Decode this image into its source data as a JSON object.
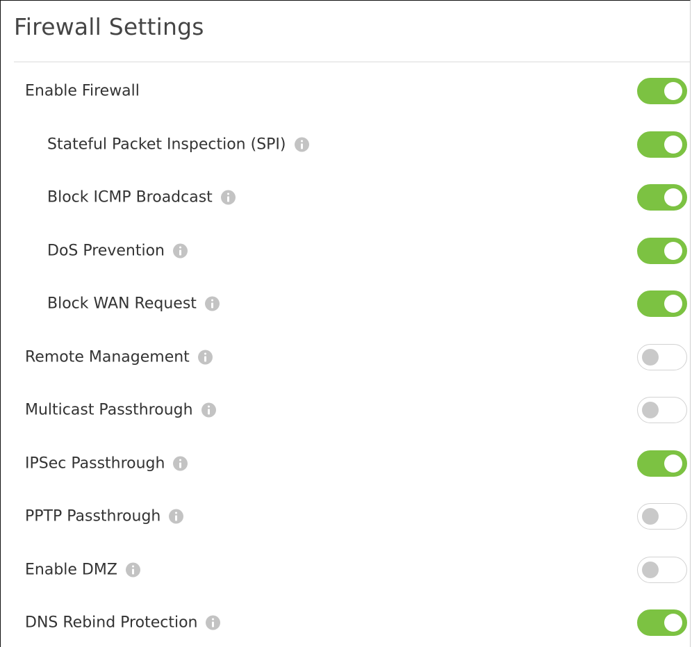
{
  "page": {
    "title": "Firewall Settings"
  },
  "colors": {
    "toggle_on": "#7cc242",
    "toggle_off_border": "#d2d2d2",
    "toggle_off_knob": "#c9c9c9",
    "info_icon": "#c3c3c3",
    "label_text": "#333333"
  },
  "settings": [
    {
      "label": "Enable Firewall",
      "enabled": true,
      "info_icon": false,
      "indent": 0
    },
    {
      "label": "Stateful Packet Inspection (SPI)",
      "enabled": true,
      "info_icon": true,
      "indent": 1
    },
    {
      "label": "Block ICMP Broadcast",
      "enabled": true,
      "info_icon": true,
      "indent": 1
    },
    {
      "label": "DoS Prevention",
      "enabled": true,
      "info_icon": true,
      "indent": 1
    },
    {
      "label": "Block WAN Request",
      "enabled": true,
      "info_icon": true,
      "indent": 1
    },
    {
      "label": "Remote Management",
      "enabled": false,
      "info_icon": true,
      "indent": 0
    },
    {
      "label": "Multicast Passthrough",
      "enabled": false,
      "info_icon": true,
      "indent": 0
    },
    {
      "label": "IPSec Passthrough",
      "enabled": true,
      "info_icon": true,
      "indent": 0
    },
    {
      "label": "PPTP Passthrough",
      "enabled": false,
      "info_icon": true,
      "indent": 0
    },
    {
      "label": "Enable DMZ",
      "enabled": false,
      "info_icon": true,
      "indent": 0
    },
    {
      "label": "DNS Rebind Protection",
      "enabled": true,
      "info_icon": true,
      "indent": 0
    }
  ]
}
